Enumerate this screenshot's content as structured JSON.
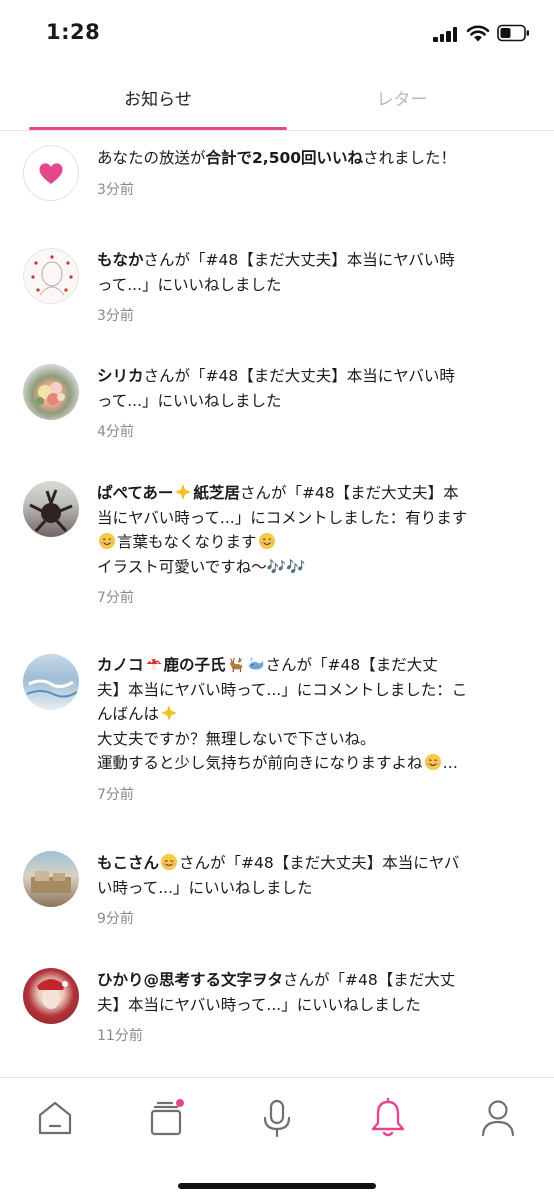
{
  "status_bar": {
    "time": "1:28"
  },
  "tabs": [
    {
      "label": "お知らせ",
      "active": true
    },
    {
      "label": "レター",
      "active": false
    }
  ],
  "colors": {
    "accent": "#e4478d",
    "muted": "#8a8a8a"
  },
  "notifications": [
    {
      "avatar_icon": "heart-icon",
      "parts": [
        "あなたの放送が",
        "合計で2,500回いいね",
        "されました！"
      ],
      "time": "3分前"
    },
    {
      "avatar_icon": "user-avatar",
      "user": "もなか",
      "line1": "さんが「#48【まだ大丈夫】本当にヤバい時",
      "line2": "って...」にいいねしました",
      "time": "3分前"
    },
    {
      "avatar_icon": "user-avatar",
      "user": "シリカ",
      "line1": "さんが「#48【まだ大丈夫】本当にヤバい時",
      "line2": "って...」にいいねしました",
      "time": "4分前"
    },
    {
      "avatar_icon": "user-avatar",
      "user": "ぱぺてあー",
      "user_emoji": "sparkle-star-emoji",
      "user2": "紙芝居",
      "line1": "さんが「#48【まだ大丈夫】本",
      "line2": "当にヤバい時って...」にコメントしました：有ります",
      "line3_emoji": "smile-emoji",
      "line3": "言葉もなくなります",
      "line3_emoji2": "smile-emoji",
      "line4": "イラスト可愛いですね〜🎶🎶",
      "time": "7分前"
    },
    {
      "avatar_icon": "user-avatar",
      "user": "カノコ",
      "user_emoji": "mushroom-emoji",
      "user2": "鹿の子氏",
      "user_emoji2": "deer-emoji",
      "user_emoji3": "whale-emoji",
      "line1": "さんが「#48【まだ大丈",
      "line2": "夫】本当にヤバい時って...」にコメントしました：こ",
      "line3": "んばんは",
      "line3_emoji": "sparkle-star-emoji",
      "line4": "大丈夫ですか？無理しないで下さいね。",
      "line5": "運動すると少し気持ちが前向きになりますよね",
      "line5_emoji": "smile-emoji",
      "line5_tail": "…",
      "time": "7分前"
    },
    {
      "avatar_icon": "user-avatar",
      "user": "もこさん",
      "user_emoji": "relaxed-emoji",
      "line1": "さんが「#48【まだ大丈夫】本当にヤバ",
      "line2": "い時って...」にいいねしました",
      "time": "9分前"
    },
    {
      "avatar_icon": "user-avatar",
      "user": "ひかり@思考する文字ヲタ",
      "line1": "さんが「#48【まだ大丈",
      "line2": "夫】本当にヤバい時って...」にいいねしました",
      "time": "11分前"
    }
  ],
  "bottom_nav": [
    {
      "name": "home",
      "icon": "home-icon",
      "active": false
    },
    {
      "name": "timeline",
      "icon": "cards-icon",
      "active": false,
      "badge": true
    },
    {
      "name": "broadcast",
      "icon": "microphone-icon",
      "active": false
    },
    {
      "name": "notifications",
      "icon": "bell-icon",
      "active": true
    },
    {
      "name": "profile",
      "icon": "person-icon",
      "active": false
    }
  ]
}
